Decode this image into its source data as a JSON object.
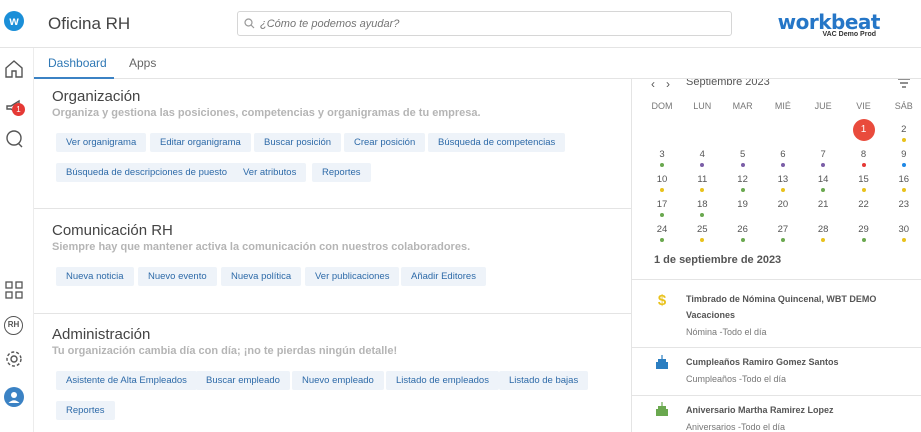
{
  "header": {
    "logo_letter": "w",
    "app_title": "Oficina RH",
    "search_placeholder": "¿Cómo te podemos ayudar?",
    "brand_name": "workbeat",
    "brand_sub": "VAC Demo Prod"
  },
  "sidebar": {
    "notification_count": "1",
    "rh_label": "RH"
  },
  "tabs": [
    {
      "label": "Dashboard",
      "active": true
    },
    {
      "label": "Apps",
      "active": false
    }
  ],
  "sections": {
    "org": {
      "title": "Organización",
      "subtitle": "Organiza y gestiona las posiciones, competencias y organigramas de tu empresa.",
      "actions": [
        "Ver organigrama",
        "Editar organigrama",
        "Buscar posición",
        "Crear posición",
        "Búsqueda de competencias",
        "Búsqueda de descripciones de puesto",
        "Ver atributos",
        "Reportes"
      ]
    },
    "com": {
      "title": "Comunicación RH",
      "subtitle": "Siempre hay que mantener activa la comunicación con nuestros colaboradores.",
      "actions": [
        "Nueva noticia",
        "Nuevo evento",
        "Nueva política",
        "Ver publicaciones",
        "Añadir Editores"
      ]
    },
    "adm": {
      "title": "Administración",
      "subtitle": "Tu organización cambia día con día; ¡no te pierdas ningún detalle!",
      "actions": [
        "Asistente de Alta Empleados",
        "Buscar empleado",
        "Nuevo empleado",
        "Listado de empleados",
        "Listado de bajas",
        "Reportes"
      ]
    }
  },
  "calendar": {
    "month_label": "Septiembre 2023",
    "weekdays": [
      "DOM",
      "LUN",
      "MAR",
      "MIÉ",
      "JUE",
      "VIE",
      "SÁB"
    ],
    "days": [
      {
        "d": "1",
        "col": 5,
        "row": 0,
        "today": true,
        "dots": []
      },
      {
        "d": "2",
        "col": 6,
        "row": 0,
        "dots": [
          "#e9c21c"
        ]
      },
      {
        "d": "3",
        "col": 0,
        "row": 1,
        "dots": [
          "#6aa84f"
        ]
      },
      {
        "d": "4",
        "col": 1,
        "row": 1,
        "dots": [
          "#7b5ea7"
        ]
      },
      {
        "d": "5",
        "col": 2,
        "row": 1,
        "dots": [
          "#7b5ea7"
        ]
      },
      {
        "d": "6",
        "col": 3,
        "row": 1,
        "dots": [
          "#7b5ea7"
        ]
      },
      {
        "d": "7",
        "col": 4,
        "row": 1,
        "dots": [
          "#7b5ea7"
        ]
      },
      {
        "d": "8",
        "col": 5,
        "row": 1,
        "dots": [
          "#e53935"
        ]
      },
      {
        "d": "9",
        "col": 6,
        "row": 1,
        "dots": [
          "#1e88e5"
        ]
      },
      {
        "d": "10",
        "col": 0,
        "row": 2,
        "dots": [
          "#e9c21c"
        ]
      },
      {
        "d": "11",
        "col": 1,
        "row": 2,
        "dots": [
          "#e9c21c"
        ]
      },
      {
        "d": "12",
        "col": 2,
        "row": 2,
        "dots": [
          "#6aa84f"
        ]
      },
      {
        "d": "13",
        "col": 3,
        "row": 2,
        "dots": [
          "#e9c21c"
        ]
      },
      {
        "d": "14",
        "col": 4,
        "row": 2,
        "dots": [
          "#6aa84f"
        ]
      },
      {
        "d": "15",
        "col": 5,
        "row": 2,
        "dots": [
          "#e9c21c"
        ]
      },
      {
        "d": "16",
        "col": 6,
        "row": 2,
        "dots": [
          "#e9c21c"
        ]
      },
      {
        "d": "17",
        "col": 0,
        "row": 3,
        "dots": [
          "#6aa84f"
        ]
      },
      {
        "d": "18",
        "col": 1,
        "row": 3,
        "dots": [
          "#6aa84f"
        ]
      },
      {
        "d": "19",
        "col": 2,
        "row": 3,
        "dots": []
      },
      {
        "d": "20",
        "col": 3,
        "row": 3,
        "dots": []
      },
      {
        "d": "21",
        "col": 4,
        "row": 3,
        "dots": []
      },
      {
        "d": "22",
        "col": 5,
        "row": 3,
        "dots": []
      },
      {
        "d": "23",
        "col": 6,
        "row": 3,
        "dots": []
      },
      {
        "d": "24",
        "col": 0,
        "row": 4,
        "dots": [
          "#6aa84f"
        ]
      },
      {
        "d": "25",
        "col": 1,
        "row": 4,
        "dots": [
          "#e9c21c"
        ]
      },
      {
        "d": "26",
        "col": 2,
        "row": 4,
        "dots": [
          "#6aa84f"
        ]
      },
      {
        "d": "27",
        "col": 3,
        "row": 4,
        "dots": [
          "#6aa84f"
        ]
      },
      {
        "d": "28",
        "col": 4,
        "row": 4,
        "dots": [
          "#e9c21c"
        ]
      },
      {
        "d": "29",
        "col": 5,
        "row": 4,
        "dots": [
          "#6aa84f"
        ]
      },
      {
        "d": "30",
        "col": 6,
        "row": 4,
        "dots": [
          "#e9c21c"
        ]
      }
    ],
    "selected_date": "1 de septiembre de 2023"
  },
  "events": [
    {
      "icon": "dollar-icon",
      "title": "Timbrado de Nómina Quincenal, WBT DEMO",
      "title2": "Vacaciones",
      "sub": "Nómina -Todo el día"
    },
    {
      "icon": "cake-icon",
      "title": "Cumpleaños Ramiro Gomez Santos",
      "sub": "Cumpleaños -Todo el día"
    },
    {
      "icon": "anniversary-cake-icon",
      "title": "Aniversario Martha Ramirez Lopez",
      "sub": "Aniversarios -Todo el día"
    }
  ],
  "colors": {
    "accent": "#2f78b5",
    "chip_bg": "#eef3f9",
    "today": "#e94b3c"
  }
}
